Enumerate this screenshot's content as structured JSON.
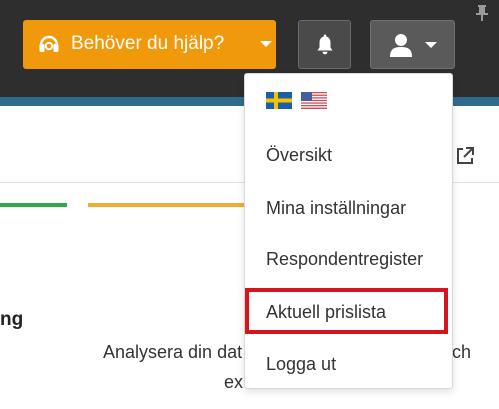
{
  "header": {
    "help_button_label": "Behöver du hjälp?",
    "icons": {
      "headset": "headset-icon",
      "bell": "bell-icon",
      "user": "user-icon",
      "pin": "pin-icon"
    },
    "colors": {
      "bar": "#2e2e2e",
      "accent": "#f09a0b",
      "stripe": "#2f6b8f"
    }
  },
  "content": {
    "fragment_heading": "ng",
    "fragment_text_left": "Analysera din dat",
    "fragment_text_right": "ch",
    "fragment_text_second_line": "ex"
  },
  "dropdown": {
    "languages": [
      "swedish-flag",
      "us-flag"
    ],
    "items": [
      {
        "label": "Översikt"
      },
      {
        "label": "Mina inställningar"
      },
      {
        "label": "Respondentregister"
      },
      {
        "label": "Aktuell prislista",
        "highlighted": true
      },
      {
        "label": "Logga ut"
      }
    ],
    "highlight_color": "#d6141c"
  }
}
